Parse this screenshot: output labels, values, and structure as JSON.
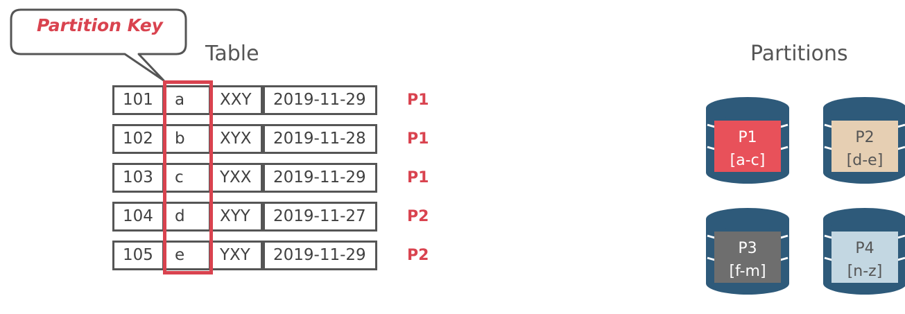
{
  "callout": {
    "label": "Partition Key"
  },
  "table": {
    "title": "Table",
    "rows": [
      {
        "id": "101",
        "key": "a",
        "code": "XXY",
        "date": "2019-11-29",
        "partition": "P1"
      },
      {
        "id": "102",
        "key": "b",
        "code": "XYX",
        "date": "2019-11-28",
        "partition": "P1"
      },
      {
        "id": "103",
        "key": "c",
        "code": "YXX",
        "date": "2019-11-29",
        "partition": "P1"
      },
      {
        "id": "104",
        "key": "d",
        "code": "XYY",
        "date": "2019-11-27",
        "partition": "P2"
      },
      {
        "id": "105",
        "key": "e",
        "code": "YXY",
        "date": "2019-11-29",
        "partition": "P2"
      }
    ]
  },
  "partitions": {
    "title": "Partitions",
    "items": [
      {
        "name": "P1",
        "range": "[a-c]",
        "color": "#e8515a"
      },
      {
        "name": "P2",
        "range": "[d-e]",
        "color": "#e6cfb3"
      },
      {
        "name": "P3",
        "range": "[f-m]",
        "color": "#6e6e6e"
      },
      {
        "name": "P4",
        "range": "[n-z]",
        "color": "#c3d7e2"
      }
    ]
  },
  "colors": {
    "accent": "#d9434f",
    "cylinder": "#2e5a7a",
    "border": "#555555"
  }
}
